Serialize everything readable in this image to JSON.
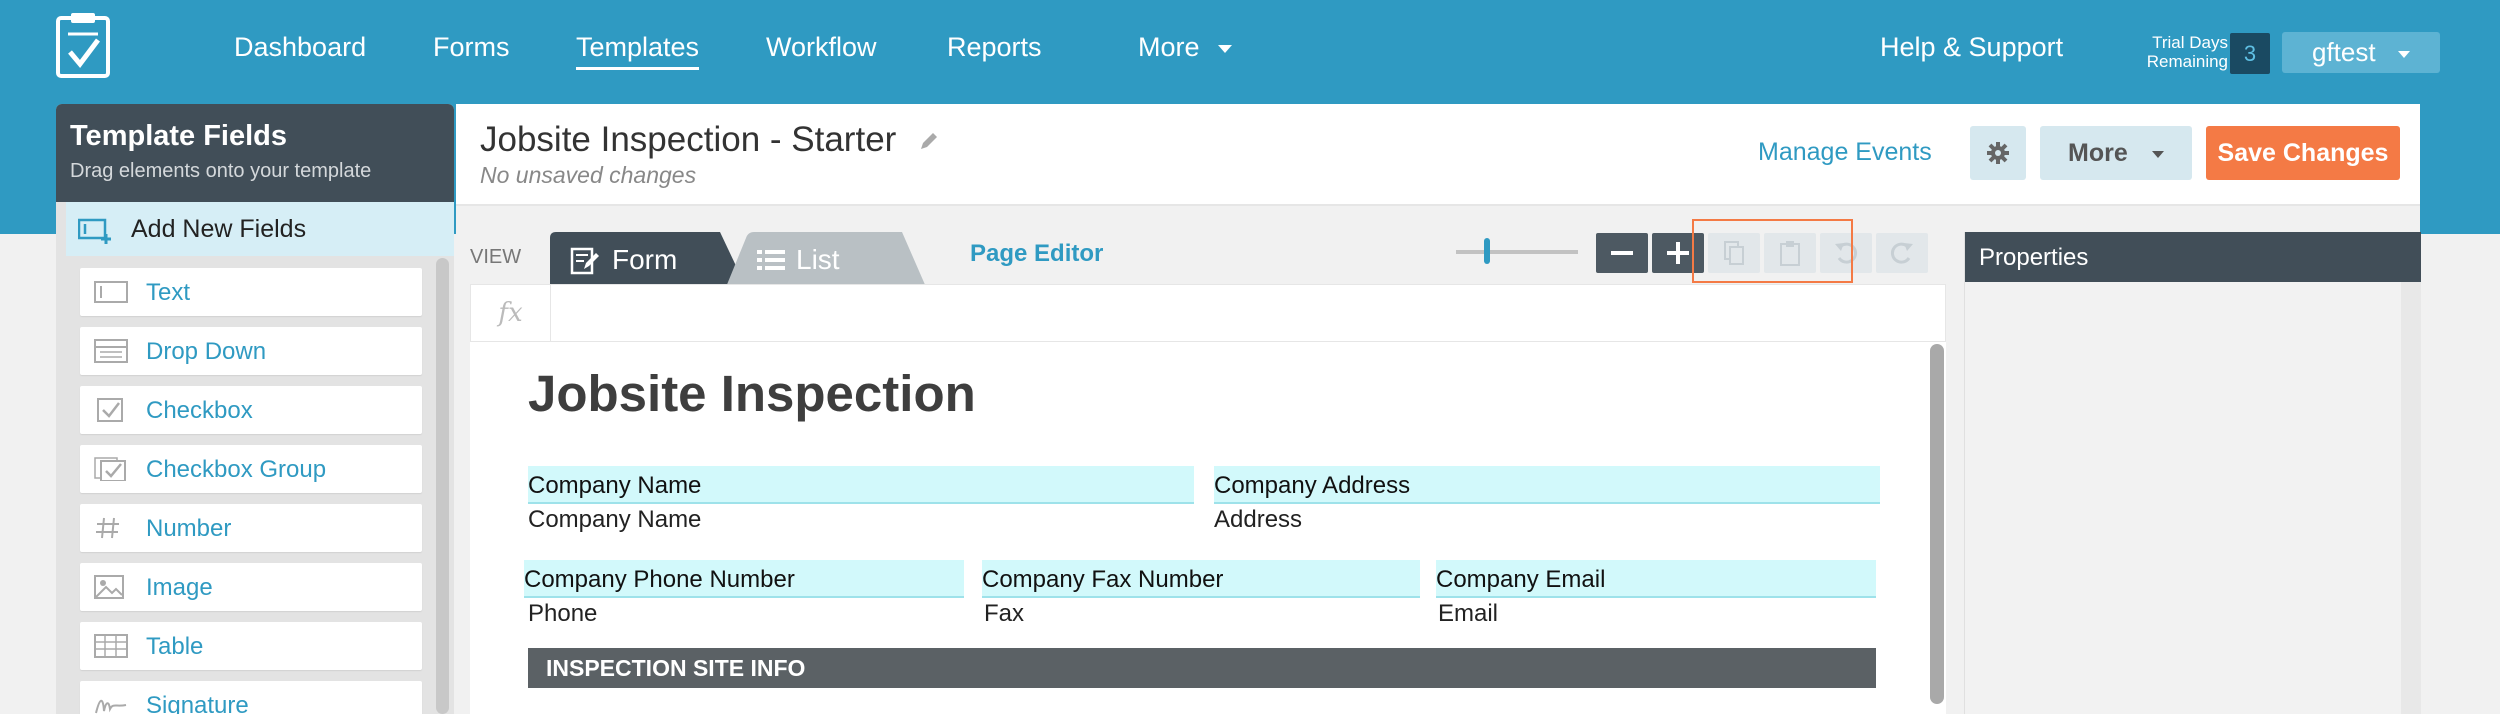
{
  "nav": {
    "items": [
      {
        "label": "Dashboard",
        "active": false
      },
      {
        "label": "Forms",
        "active": false
      },
      {
        "label": "Templates",
        "active": true
      },
      {
        "label": "Workflow",
        "active": false
      },
      {
        "label": "Reports",
        "active": false
      }
    ],
    "more_label": "More",
    "help_label": "Help & Support",
    "trial_label": "Trial Days Remaining",
    "trial_count": "3",
    "user_label": "gftest",
    "logo_icon": "form-check-logo-icon"
  },
  "left_panel": {
    "title": "Template Fields",
    "subtitle": "Drag elements onto your template",
    "add_label": "Add New Fields",
    "fields": [
      {
        "label": "Text",
        "icon": "text-field-icon"
      },
      {
        "label": "Drop Down",
        "icon": "dropdown-icon"
      },
      {
        "label": "Checkbox",
        "icon": "checkbox-icon"
      },
      {
        "label": "Checkbox Group",
        "icon": "checkbox-group-icon"
      },
      {
        "label": "Number",
        "icon": "number-icon"
      },
      {
        "label": "Image",
        "icon": "image-icon"
      },
      {
        "label": "Table",
        "icon": "table-icon"
      },
      {
        "label": "Signature",
        "icon": "signature-icon"
      }
    ]
  },
  "header": {
    "title": "Jobsite Inspection - Starter",
    "status": "No unsaved changes",
    "manage_events": "Manage Events",
    "more_label": "More",
    "save_label": "Save Changes"
  },
  "editor": {
    "view_label": "VIEW",
    "tabs": [
      {
        "label": "Form"
      },
      {
        "label": "List"
      }
    ],
    "page_editor": "Page Editor",
    "fx_label": "fx",
    "zoom_level": 0.25
  },
  "form": {
    "title": "Jobsite Inspection",
    "row1": [
      {
        "field": "Company Name",
        "label": "Company Name"
      },
      {
        "field": "Company Address",
        "label": "Address"
      }
    ],
    "row2": [
      {
        "field": "Company Phone Number",
        "label": "Phone"
      },
      {
        "field": "Company Fax Number",
        "label": "Fax"
      },
      {
        "field": "Company Email",
        "label": "Email"
      }
    ],
    "section": "INSPECTION SITE INFO"
  },
  "properties": {
    "title": "Properties"
  },
  "colors": {
    "brand": "#2f9ac2",
    "accent": "#f47a45",
    "panel_dark": "#414e58",
    "field_highlight": "#d2f9fb"
  }
}
